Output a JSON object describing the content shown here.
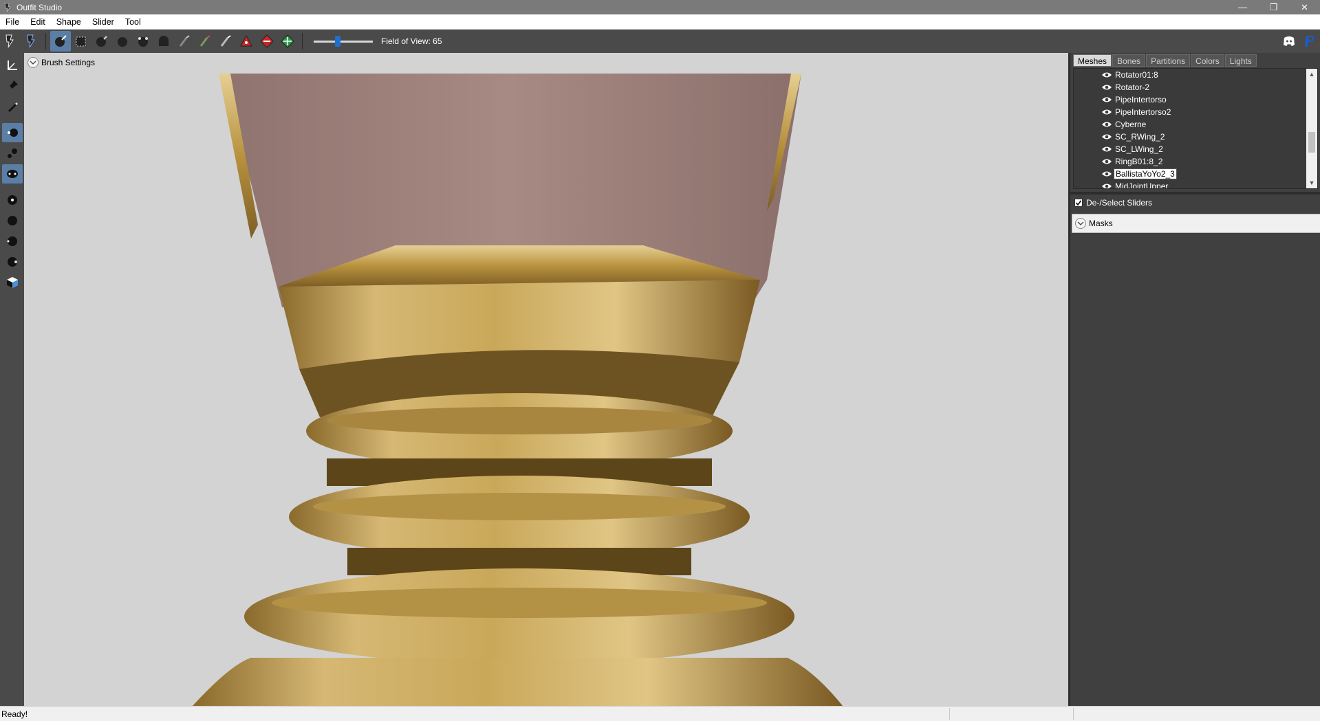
{
  "window": {
    "title": "Outfit Studio",
    "controls": [
      "minimize",
      "restore",
      "close"
    ]
  },
  "menubar": {
    "items": [
      "File",
      "Edit",
      "Shape",
      "Slider",
      "Tool"
    ]
  },
  "toolbar": {
    "fov_label": "Field of View: 65",
    "fov_value_fraction": 0.4,
    "tools": [
      "select-tool",
      "transform-tool",
      "inflate-brush",
      "mask-brush",
      "move-brush",
      "smooth-brush",
      "deflate-brush",
      "undiff-brush",
      "color-brush",
      "alpha-brush",
      "weight-brush",
      "vertex-select",
      "collapse-vertex",
      "flip-edge"
    ],
    "right_icons": [
      "discord-icon",
      "paypal-icon"
    ]
  },
  "viewport": {
    "brush_settings_label": "Brush Settings"
  },
  "right_panel": {
    "tabs": [
      {
        "label": "Meshes",
        "active": true
      },
      {
        "label": "Bones",
        "active": false
      },
      {
        "label": "Partitions",
        "active": false
      },
      {
        "label": "Colors",
        "active": false
      },
      {
        "label": "Lights",
        "active": false
      }
    ],
    "meshes": [
      {
        "label": "Rotator01:8",
        "selected": false
      },
      {
        "label": "Rotator-2",
        "selected": false
      },
      {
        "label": "PipeIntertorso",
        "selected": false
      },
      {
        "label": "PipeIntertorso2",
        "selected": false
      },
      {
        "label": "Cyberne",
        "selected": false
      },
      {
        "label": "SC_RWing_2",
        "selected": false
      },
      {
        "label": "SC_LWing_2",
        "selected": false
      },
      {
        "label": "RingB01:8_2",
        "selected": false
      },
      {
        "label": "BallistaYoYo2_3",
        "selected": true
      },
      {
        "label": "MidJointUpper",
        "selected": false
      }
    ],
    "deselect_sliders_label": "De-/Select Sliders",
    "deselect_sliders_checked": true,
    "masks_label": "Masks"
  },
  "statusbar": {
    "status": "Ready!"
  },
  "colors": {
    "accent": "#1e6fd0",
    "active_tool": "#5b7ea6",
    "panel": "#404040",
    "viewport": "#d3d3d3",
    "gold": "#c9a85a",
    "skin": "#a88880"
  }
}
